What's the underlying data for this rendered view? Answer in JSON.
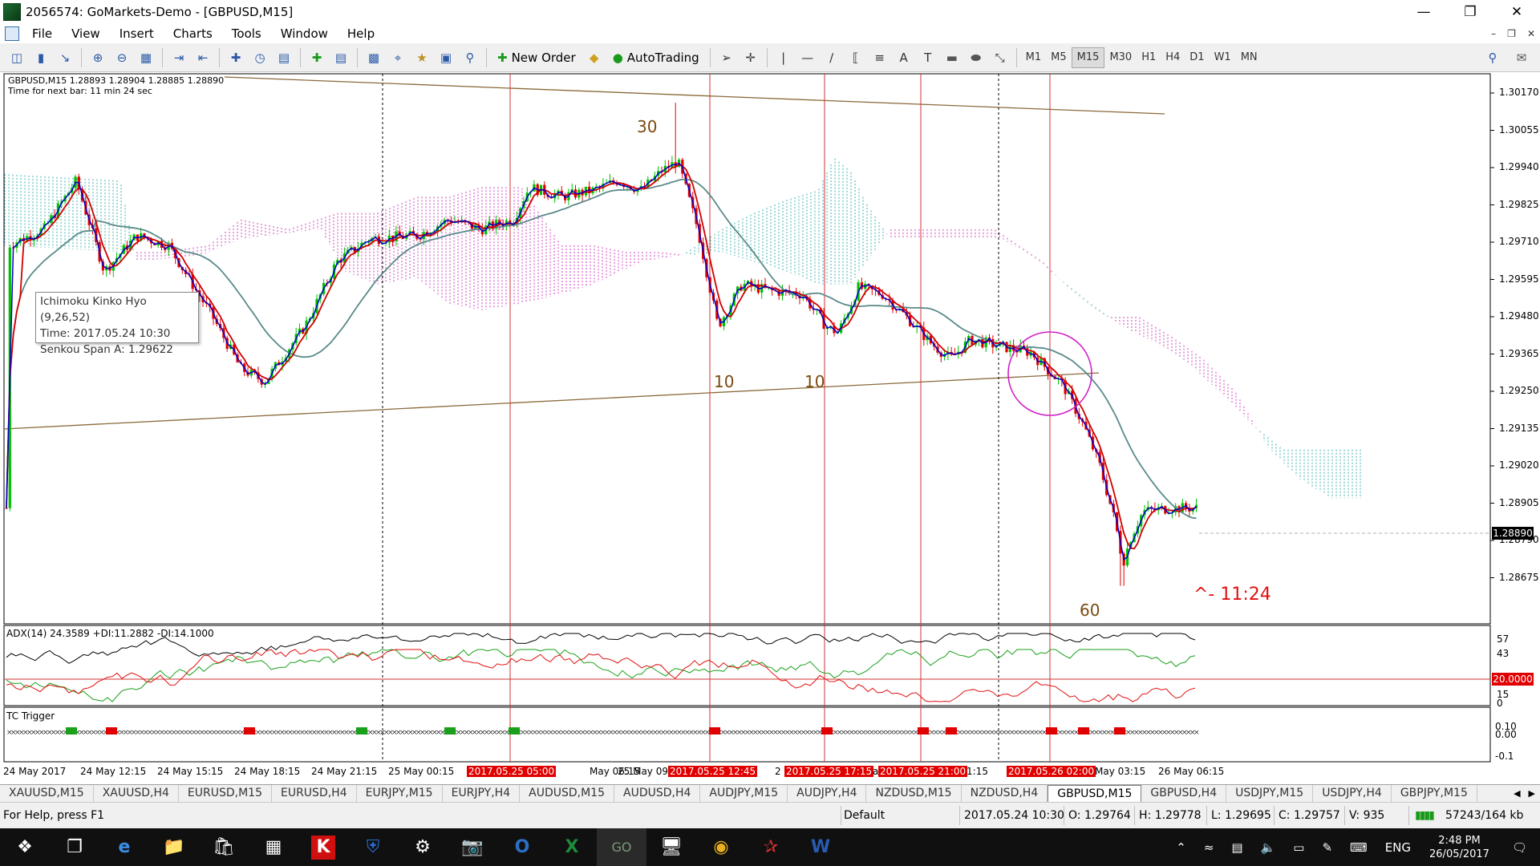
{
  "window": {
    "title": "2056574: GoMarkets-Demo - [GBPUSD,M15]"
  },
  "menu": [
    "File",
    "View",
    "Insert",
    "Charts",
    "Tools",
    "Window",
    "Help"
  ],
  "toolbar": {
    "new_order": "New Order",
    "autotrading": "AutoTrading",
    "timeframes": [
      "M1",
      "M5",
      "M15",
      "M30",
      "H1",
      "H4",
      "D1",
      "W1",
      "MN"
    ],
    "active_timeframe": "M15"
  },
  "chart": {
    "symbol_line": "GBPUSD,M15  1.28893 1.28904 1.28885 1.28890",
    "timer_line": "Time for next bar: 11 min 24 sec",
    "tooltip": [
      "Ichimoku Kinko Hyo (9,26,52)",
      "Time: 2017.05.24 10:30",
      "Senkou Span A: 1.29622"
    ],
    "price_axis": [
      "1.30170",
      "1.30055",
      "1.29940",
      "1.29825",
      "1.29710",
      "1.29595",
      "1.29480",
      "1.29365",
      "1.29250",
      "1.29135",
      "1.29020",
      "1.28905",
      "1.28790",
      "1.28675"
    ],
    "current_price": "1.28890",
    "annotations": {
      "a30": "30",
      "a10_left": "10",
      "a10_right": "10",
      "a60": "60",
      "timer_note": "^- 11:24"
    },
    "adx_label": "ADX(14) 24.3589 +DI:11.2882 -DI:14.1000",
    "adx_axis": [
      "57",
      "43",
      "15",
      "0"
    ],
    "adx_level": "20.0000",
    "tc_label": "TC Trigger",
    "tc_axis": [
      "0.10",
      "0.00",
      "-0.1"
    ],
    "time_axis": [
      "24 May 2017",
      "24 May 12:15",
      "24 May 15:15",
      "24 May 18:15",
      "24 May 21:15",
      "25 May 00:15",
      "2017.05.25 05:00",
      "May 06:15",
      "25 May 09",
      "2017.05.25 12:45",
      "2017.05.25 17:15",
      "2017.05.25 21:00",
      "1:15",
      "2017.05.26 02:00",
      "May 03:15",
      "26 May 06:15"
    ],
    "time_axis_extra": [
      "2",
      "a"
    ]
  },
  "tabs": [
    "XAUUSD,M15",
    "XAUUSD,H4",
    "EURUSD,M15",
    "EURUSD,H4",
    "EURJPY,M15",
    "EURJPY,H4",
    "AUDUSD,M15",
    "AUDUSD,H4",
    "AUDJPY,M15",
    "AUDJPY,H4",
    "NZDUSD,M15",
    "NZDUSD,H4",
    "GBPUSD,M15",
    "GBPUSD,H4",
    "USDJPY,M15",
    "USDJPY,H4",
    "GBPJPY,M15"
  ],
  "active_tab": "GBPUSD,M15",
  "status": {
    "help": "For Help, press F1",
    "profile": "Default",
    "time": "2017.05.24 10:30",
    "open": "O: 1.29764",
    "high": "H: 1.29778",
    "low": "L: 1.29695",
    "close": "C: 1.29757",
    "volume": "V: 935",
    "traffic": "57243/164 kb"
  },
  "taskbar": {
    "lang": "ENG",
    "time": "2:48 PM",
    "date": "26/05/2017"
  },
  "colors": {
    "bull": "#00c000",
    "bear": "#e00000",
    "ma_fast": "#0000c8",
    "ma_mid": "#d00000",
    "ma_slow": "#5a8a8a",
    "cloud_a": "#40b0b0",
    "cloud_b": "#d040c0",
    "vline": "#d03030",
    "trend": "#8a6a3a",
    "circle": "#d020c8"
  }
}
